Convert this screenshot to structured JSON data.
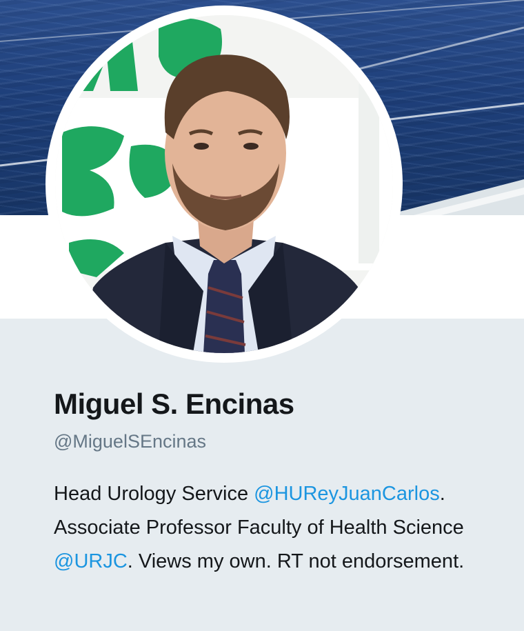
{
  "profile": {
    "display_name": "Miguel S. Encinas",
    "handle": "@MiguelSEncinas",
    "bio": {
      "part1": "Head Urology Service ",
      "mention1": "@HUReyJuanCarlos",
      "part2": ". Associate Professor Faculty of Health Science ",
      "mention2": "@URJC",
      "part3": ". Views my own. RT not endorsement."
    }
  },
  "colors": {
    "background": "#e6ecf0",
    "name": "#14171a",
    "handle": "#657786",
    "link": "#1b95e0"
  },
  "icons": {
    "avatar": "profile-photo"
  }
}
